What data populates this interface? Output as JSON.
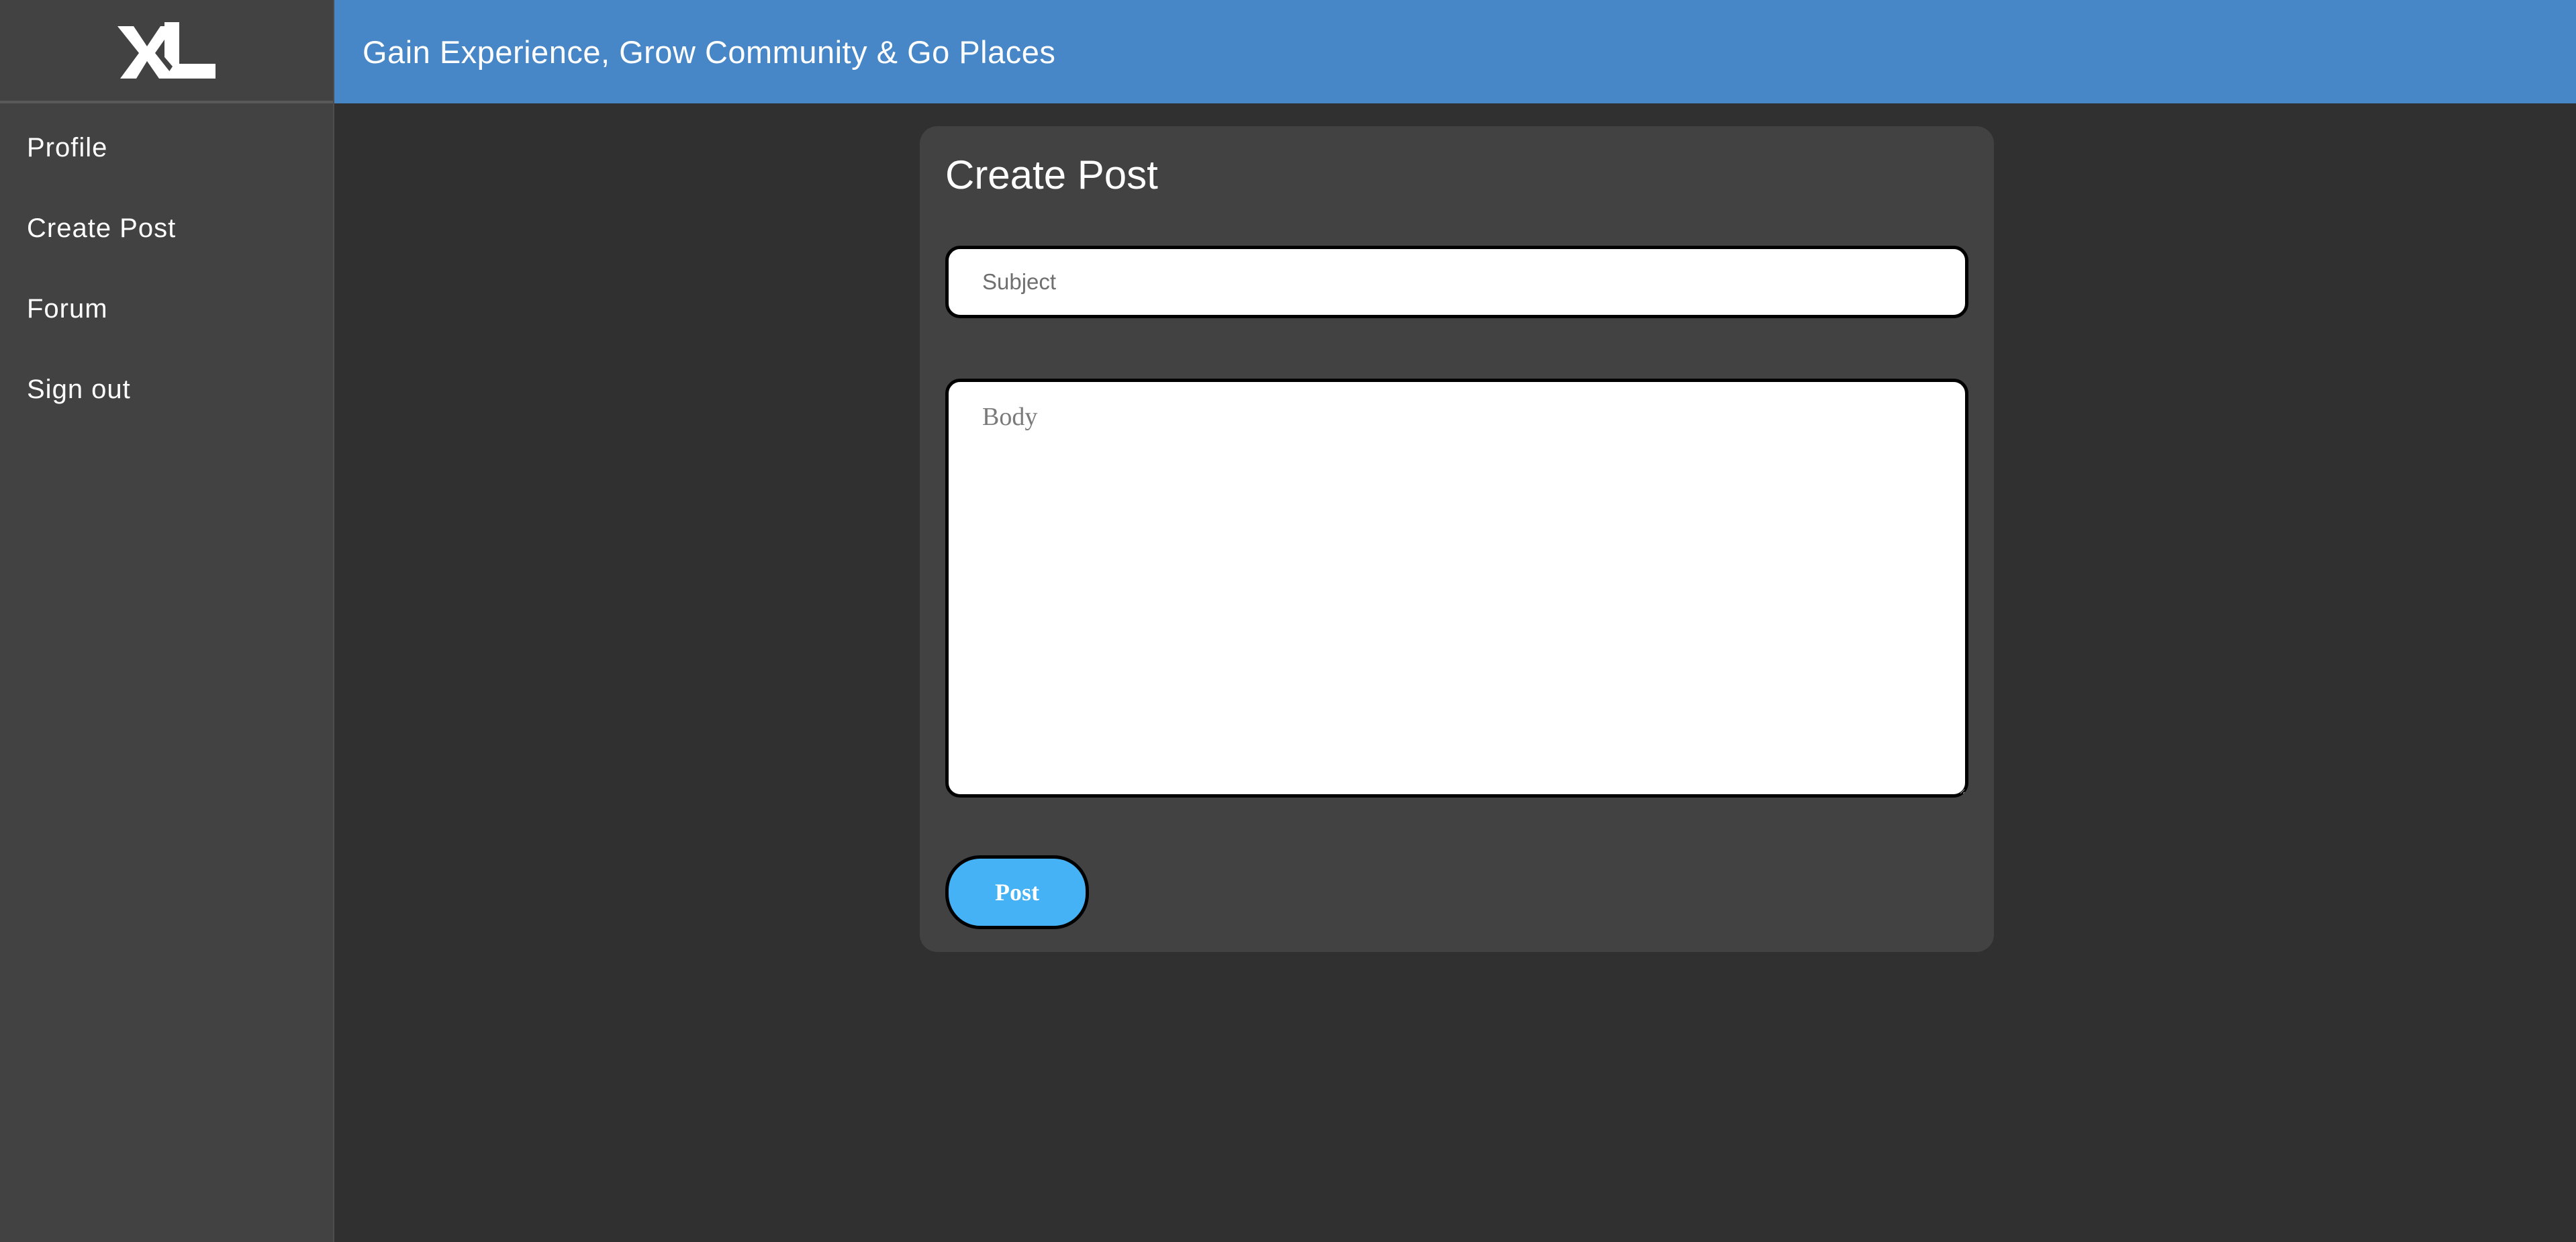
{
  "app": {
    "logo_icon": "xl-logo-icon"
  },
  "sidebar": {
    "items": [
      {
        "label": "Profile"
      },
      {
        "label": "Create Post"
      },
      {
        "label": "Forum"
      },
      {
        "label": "Sign out"
      }
    ]
  },
  "header": {
    "title": "Gain Experience, Grow Community & Go Places",
    "color": "#4787c7"
  },
  "main": {
    "card_title": "Create Post",
    "subject": {
      "placeholder": "Subject",
      "value": ""
    },
    "body": {
      "placeholder": "Body",
      "value": ""
    },
    "post_label": "Post",
    "post_color": "#44b2f5"
  }
}
